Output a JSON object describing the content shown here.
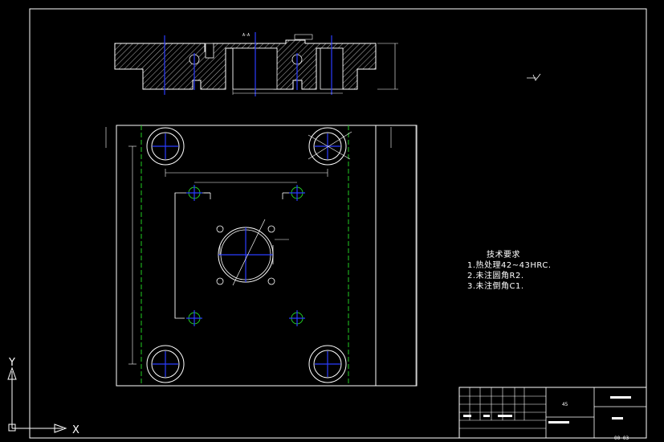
{
  "technical_requirements": {
    "title": "技术要求",
    "items": [
      "1.热处理42~43HRC.",
      "2.未注圆角R2.",
      "3.未注倒角C1."
    ]
  },
  "ucs": {
    "y_label": "Y",
    "x_label": "X"
  },
  "title_block": {
    "material": "45",
    "drawing_no": "00-03"
  },
  "section_label": "A-A",
  "colors": {
    "background": "#000000",
    "outline": "#ffffff",
    "center_line": "#2b3cff",
    "hidden_line": "#22cc22",
    "hatch": "#ffffff"
  }
}
